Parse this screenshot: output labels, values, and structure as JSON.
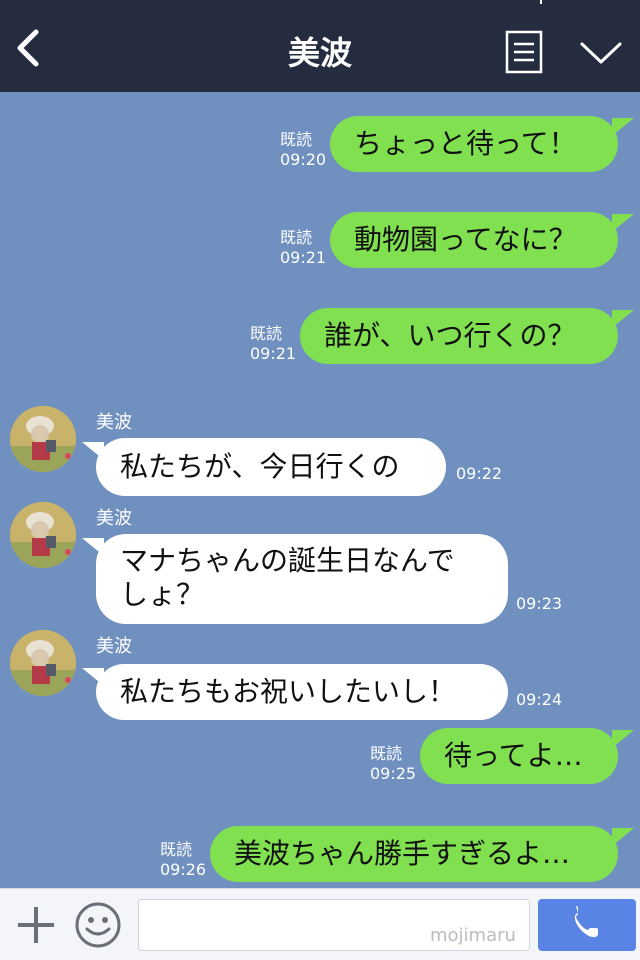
{
  "header": {
    "title": "美波"
  },
  "messages_out": [
    {
      "text": "ちょっと待って！",
      "read": "既読",
      "time": "09:20"
    },
    {
      "text": "動物園ってなに？",
      "read": "既読",
      "time": "09:21"
    },
    {
      "text": "誰が、いつ行くの？",
      "read": "既読",
      "time": "09:21"
    },
    {
      "text": "待ってよ…",
      "read": "既読",
      "time": "09:25"
    },
    {
      "text": "美波ちゃん勝手すぎるよ…",
      "read": "既読",
      "time": "09:26"
    }
  ],
  "messages_in": [
    {
      "sender": "美波",
      "text": "私たちが、今日行くの",
      "time": "09:22"
    },
    {
      "sender": "美波",
      "line1": "マナちゃんの誕生日なんで",
      "line2": "しょ？",
      "time": "09:23"
    },
    {
      "sender": "美波",
      "text": "私たちもお祝いしたいし！",
      "time": "09:24"
    }
  ],
  "footer": {
    "watermark": "mojimaru"
  },
  "colors": {
    "header_bg": "#252c40",
    "chat_bg": "#7090c0",
    "bubble_out": "#80e050",
    "bubble_in": "#ffffff",
    "call_button": "#5a83e6"
  },
  "icons": {
    "back": "chevron-left-icon",
    "menu": "list-icon",
    "expand": "chevron-down-icon",
    "add": "plus-icon",
    "emoji": "smiley-icon",
    "call": "phone-icon"
  }
}
